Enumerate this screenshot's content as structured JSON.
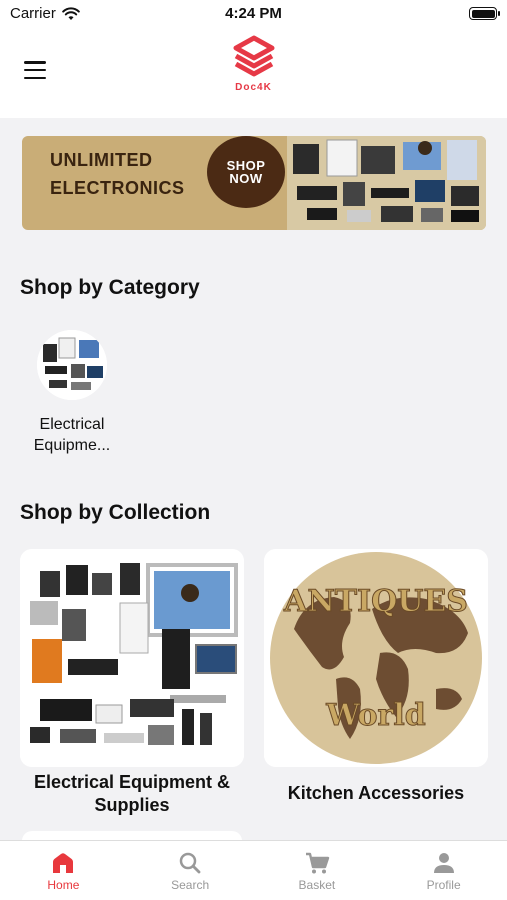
{
  "status": {
    "carrier": "Carrier",
    "time": "4:24 PM"
  },
  "header": {
    "logo_text": "Doc4K",
    "menu_icon": "hamburger-icon"
  },
  "banner": {
    "line1": "UNLIMITED",
    "line2": "ELECTRONICS",
    "cta_line1": "SHOP",
    "cta_line2": "NOW"
  },
  "category_section": {
    "title": "Shop by Category",
    "items": [
      {
        "label": "Electrical Equipme..."
      }
    ]
  },
  "collection_section": {
    "title": "Shop by Collection",
    "items": [
      {
        "label": "Electrical Equipment & Supplies"
      },
      {
        "label": "Kitchen Accessories",
        "image_text_top": "ANTIQUES",
        "image_text_bottom": "World"
      }
    ]
  },
  "tabs": [
    {
      "label": "Home",
      "icon": "home-icon",
      "active": true
    },
    {
      "label": "Search",
      "icon": "search-icon",
      "active": false
    },
    {
      "label": "Basket",
      "icon": "cart-icon",
      "active": false
    },
    {
      "label": "Profile",
      "icon": "person-icon",
      "active": false
    }
  ],
  "colors": {
    "accent": "#e8383d",
    "banner_bg": "#c9ad77",
    "banner_cta": "#4b2a14",
    "page_bg": "#f2f2f4"
  }
}
